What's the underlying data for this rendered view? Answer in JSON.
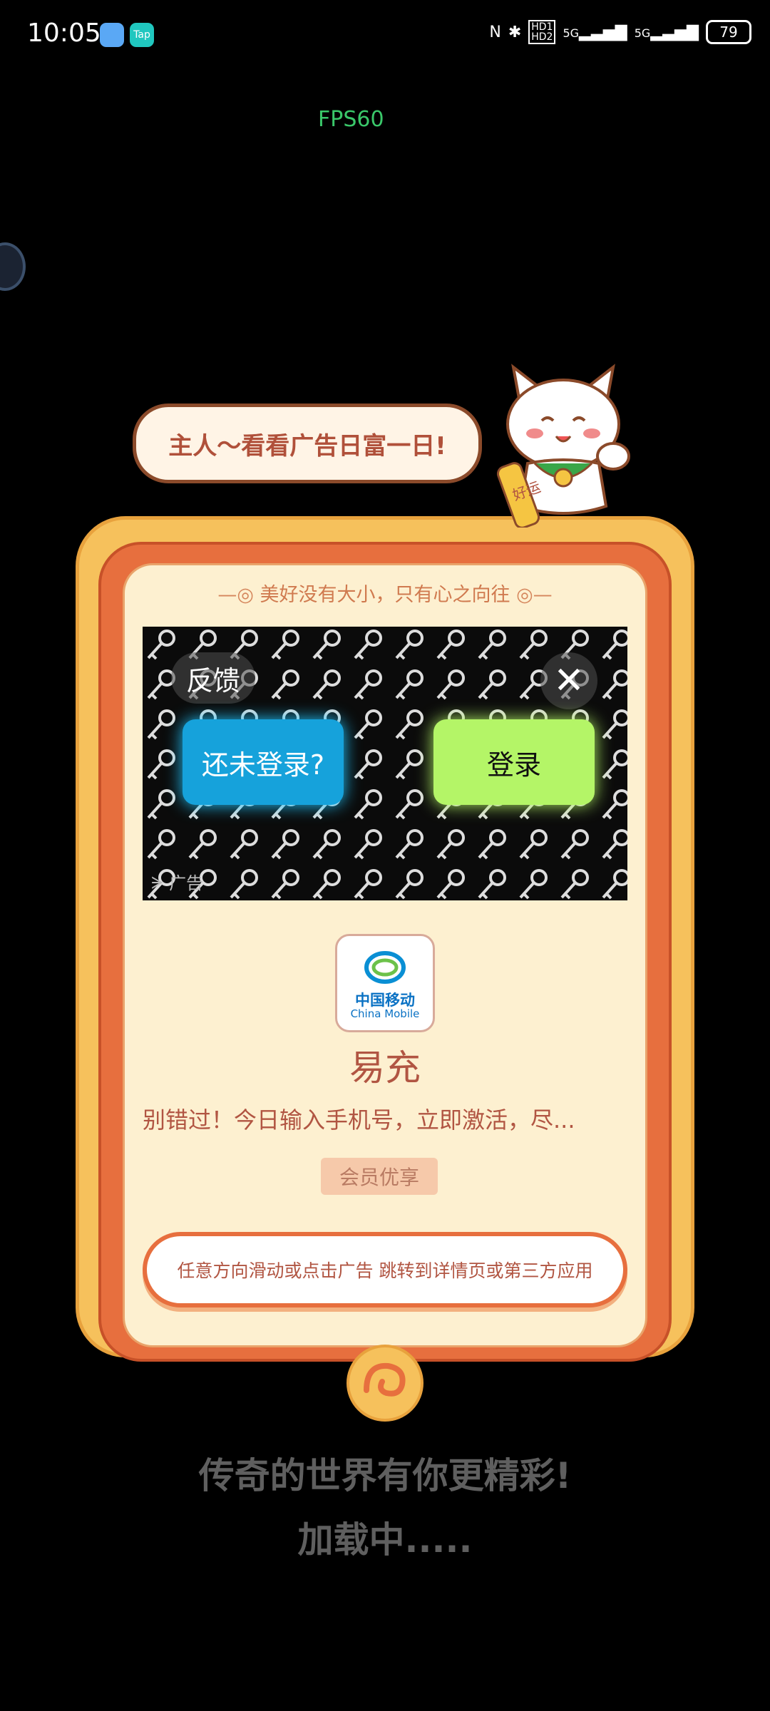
{
  "status_bar": {
    "time": "10:05",
    "network_1": "5G",
    "network_2": "5G",
    "battery": "79",
    "hd_label_1": "HD1",
    "hd_label_2": "HD2"
  },
  "overlay": {
    "fps": "FPS60"
  },
  "background_text": {
    "line_2": "传奇的世界有你更精彩!",
    "line_3": "加载中....."
  },
  "speech_bubble": {
    "text": "主人～看看广告日富一日!"
  },
  "mascot": {
    "badge_text": "好运"
  },
  "ad_card": {
    "motto": "美好没有大小，只有心之向往",
    "feedback_label": "反馈",
    "close_icon": "close-icon",
    "login_question_label": "还未登录?",
    "login_label": "登录",
    "ad_tag": "广告",
    "logo_text_cn": "中国移动",
    "logo_text_en": "China Mobile",
    "brand_name": "易充",
    "description": "别错过！今日输入手机号，立即激活，尽...",
    "tag": "会员优享",
    "cta": "任意方向滑动或点击广告 跳转到详情页或第三方应用"
  },
  "colors": {
    "accent_orange": "#e76f3e",
    "frame_gold": "#f6c15c",
    "panel_cream": "#fdf0d0",
    "login_blue": "#16a2db",
    "login_green": "#b4f567"
  }
}
